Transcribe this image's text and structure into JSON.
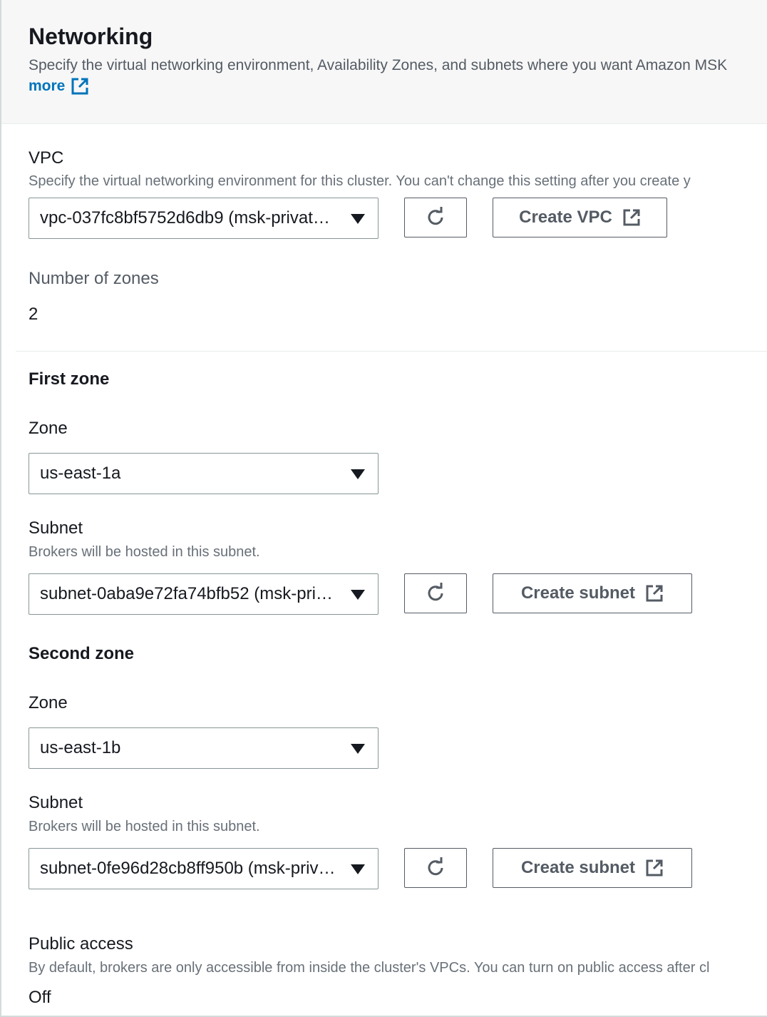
{
  "section": {
    "title": "Networking",
    "description": "Specify the virtual networking environment, Availability Zones, and subnets where you want Amazon MSK",
    "learn_more": "more"
  },
  "vpc": {
    "label": "VPC",
    "description": "Specify the virtual networking environment for this cluster. You can't change this setting after you create y",
    "selected": "vpc-037fc8bf5752d6db9 (msk-private-vpc)",
    "create_label": "Create VPC"
  },
  "zones_count": {
    "label": "Number of zones",
    "value": "2"
  },
  "first_zone": {
    "heading": "First zone",
    "zone_label": "Zone",
    "zone_value": "us-east-1a",
    "subnet_label": "Subnet",
    "subnet_description": "Brokers will be hosted in this subnet.",
    "subnet_value": "subnet-0aba9e72fa74bfb52 (msk-private-subnet-1a)",
    "create_label": "Create subnet"
  },
  "second_zone": {
    "heading": "Second zone",
    "zone_label": "Zone",
    "zone_value": "us-east-1b",
    "subnet_label": "Subnet",
    "subnet_description": "Brokers will be hosted in this subnet.",
    "subnet_value": "subnet-0fe96d28cb8ff950b (msk-private-subnet-1b)",
    "create_label": "Create subnet"
  },
  "public_access": {
    "label": "Public access",
    "description": "By default, brokers are only accessible from inside the cluster's VPCs. You can turn on public access after cl",
    "value": "Off"
  },
  "colors": {
    "link": "#0073bb",
    "header_bg": "#f7f7f7",
    "border": "#879596",
    "button_text": "#545b64"
  }
}
